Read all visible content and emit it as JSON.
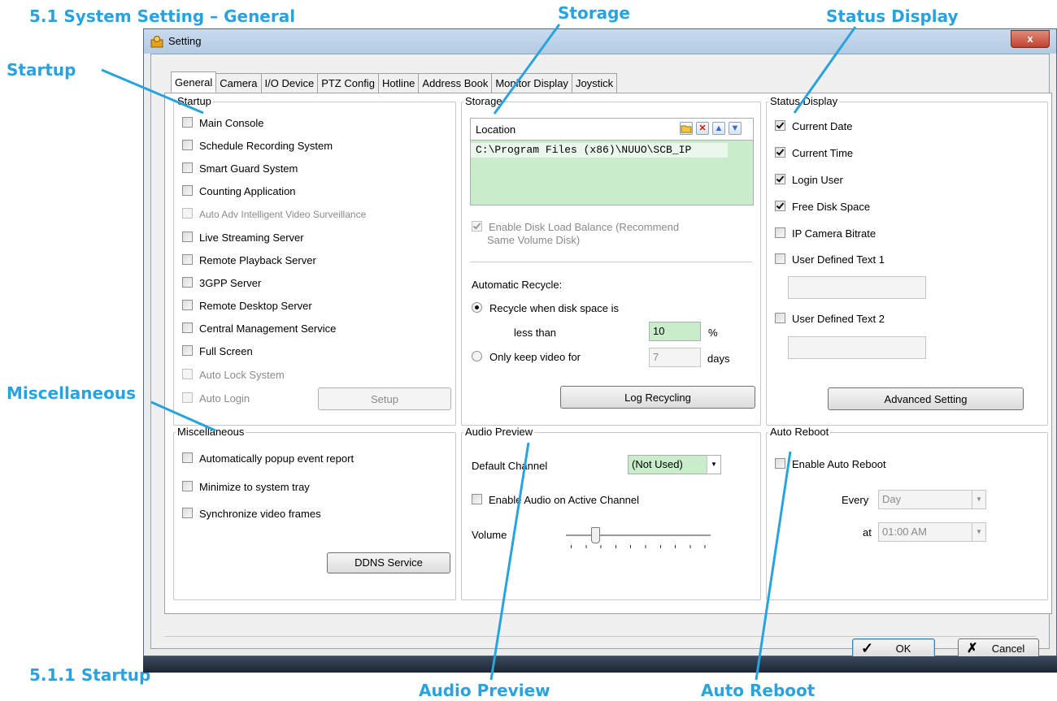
{
  "callouts": {
    "heading": "5.1 System Setting – General",
    "startup": "Startup",
    "storage": "Storage",
    "status_display": "Status Display",
    "miscellaneous": "Miscellaneous",
    "subheading": "5.1.1 Startup",
    "audio_preview": "Audio Preview",
    "auto_reboot": "Auto Reboot"
  },
  "window": {
    "title": "Setting",
    "close_label": "x"
  },
  "tabs": [
    "General",
    "Camera",
    "I/O Device",
    "PTZ Config",
    "Hotline",
    "Address Book",
    "Monitor Display",
    "Joystick"
  ],
  "startup": {
    "title": "Startup",
    "items": [
      {
        "label": "Main Console",
        "checked": false,
        "enabled": true
      },
      {
        "label": "Schedule Recording System",
        "checked": false,
        "enabled": true
      },
      {
        "label": "Smart Guard System",
        "checked": false,
        "enabled": true
      },
      {
        "label": "Counting Application",
        "checked": false,
        "enabled": true
      },
      {
        "label": "Auto Adv Intelligent Video Surveillance",
        "checked": false,
        "enabled": false
      },
      {
        "label": "Live Streaming Server",
        "checked": false,
        "enabled": true
      },
      {
        "label": "Remote Playback Server",
        "checked": false,
        "enabled": true
      },
      {
        "label": "3GPP Server",
        "checked": false,
        "enabled": true
      },
      {
        "label": "Remote Desktop Server",
        "checked": false,
        "enabled": true
      },
      {
        "label": "Central Management Service",
        "checked": false,
        "enabled": true
      },
      {
        "label": "Full Screen",
        "checked": false,
        "enabled": true
      },
      {
        "label": "Auto Lock System",
        "checked": false,
        "enabled": false
      },
      {
        "label": "Auto Login",
        "checked": false,
        "enabled": false
      }
    ],
    "setup_label": "Setup"
  },
  "storage": {
    "title": "Storage",
    "location_header": "Location",
    "location_path": "C:\\Program Files (x86)\\NUUO\\SCB_IP",
    "load_balance_line1": "Enable Disk Load Balance (Recommend",
    "load_balance_line2": "Same Volume Disk)",
    "auto_recycle_label": "Automatic Recycle:",
    "recycle_option_line1": "Recycle when disk space is",
    "recycle_option_line2": "less than",
    "recycle_value": "10",
    "recycle_unit": "%",
    "keep_option": "Only keep video for",
    "keep_value": "7",
    "keep_unit": "days",
    "log_recycling_label": "Log Recycling"
  },
  "status_display": {
    "title": "Status Display",
    "items": [
      {
        "label": "Current Date",
        "checked": true
      },
      {
        "label": "Current Time",
        "checked": true
      },
      {
        "label": "Login User",
        "checked": true
      },
      {
        "label": "Free Disk Space",
        "checked": true
      },
      {
        "label": "IP Camera Bitrate",
        "checked": false
      },
      {
        "label": "User Defined Text 1",
        "checked": false
      },
      {
        "label": "User Defined Text 2",
        "checked": false
      }
    ],
    "advanced_label": "Advanced Setting"
  },
  "miscellaneous": {
    "title": "Miscellaneous",
    "items": [
      {
        "label": "Automatically popup event report",
        "checked": false
      },
      {
        "label": "Minimize to system tray",
        "checked": false
      },
      {
        "label": "Synchronize video frames",
        "checked": false
      }
    ],
    "ddns_label": "DDNS Service"
  },
  "audio_preview": {
    "title": "Audio Preview",
    "default_channel_label": "Default Channel",
    "default_channel_value": "(Not Used)",
    "enable_audio_label": "Enable Audio on Active Channel",
    "volume_label": "Volume",
    "volume_level": 0.2
  },
  "auto_reboot": {
    "title": "Auto Reboot",
    "enable_label": "Enable Auto Reboot",
    "every_label": "Every",
    "every_value": "Day",
    "at_label": "at",
    "at_value": "01:00 AM"
  },
  "footer": {
    "ok_label": "OK",
    "cancel_label": "Cancel"
  },
  "colors": {
    "callout": "#29a3e0",
    "list_background": "#c9eccb"
  }
}
